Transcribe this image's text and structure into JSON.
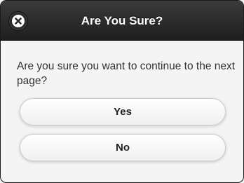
{
  "dialog": {
    "title": "Are You Sure?",
    "message": "Are you sure you want to continue to the next page?",
    "close_icon": "close-icon",
    "buttons": {
      "yes_label": "Yes",
      "no_label": "No"
    }
  },
  "colors": {
    "header_bg": "#252525",
    "body_bg": "#f4f4f4",
    "button_bg": "#f7f7f7",
    "text": "#333333"
  }
}
